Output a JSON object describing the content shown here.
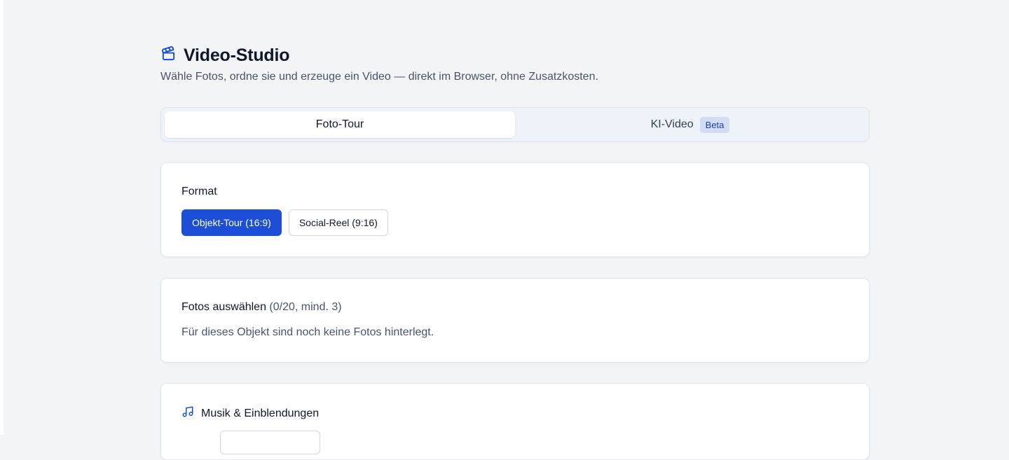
{
  "header": {
    "icon": "clapperboard-icon",
    "title": "Video-Studio",
    "subtitle": "Wähle Fotos, ordne sie und erzeuge ein Video — direkt im Browser, ohne Zusatzkosten."
  },
  "mode_tabs": {
    "items": [
      {
        "label": "Foto-Tour",
        "active": true
      },
      {
        "label": "KI-Video",
        "badge": "Beta",
        "active": false
      }
    ]
  },
  "format": {
    "heading": "Format",
    "options": [
      {
        "label": "Objekt-Tour (16:9)",
        "selected": true
      },
      {
        "label": "Social-Reel (9:16)",
        "selected": false
      }
    ]
  },
  "photos": {
    "heading": "Fotos auswählen",
    "count": "(0/20, mind. 3)",
    "empty_message": "Für dieses Objekt sind noch keine Fotos hinterlegt."
  },
  "music": {
    "icon": "music-note-icon",
    "heading": "Musik & Einblendungen"
  },
  "colors": {
    "accent": "#1d4ed8",
    "background": "#f3f4f6",
    "badge_bg": "#d2ddf3"
  }
}
